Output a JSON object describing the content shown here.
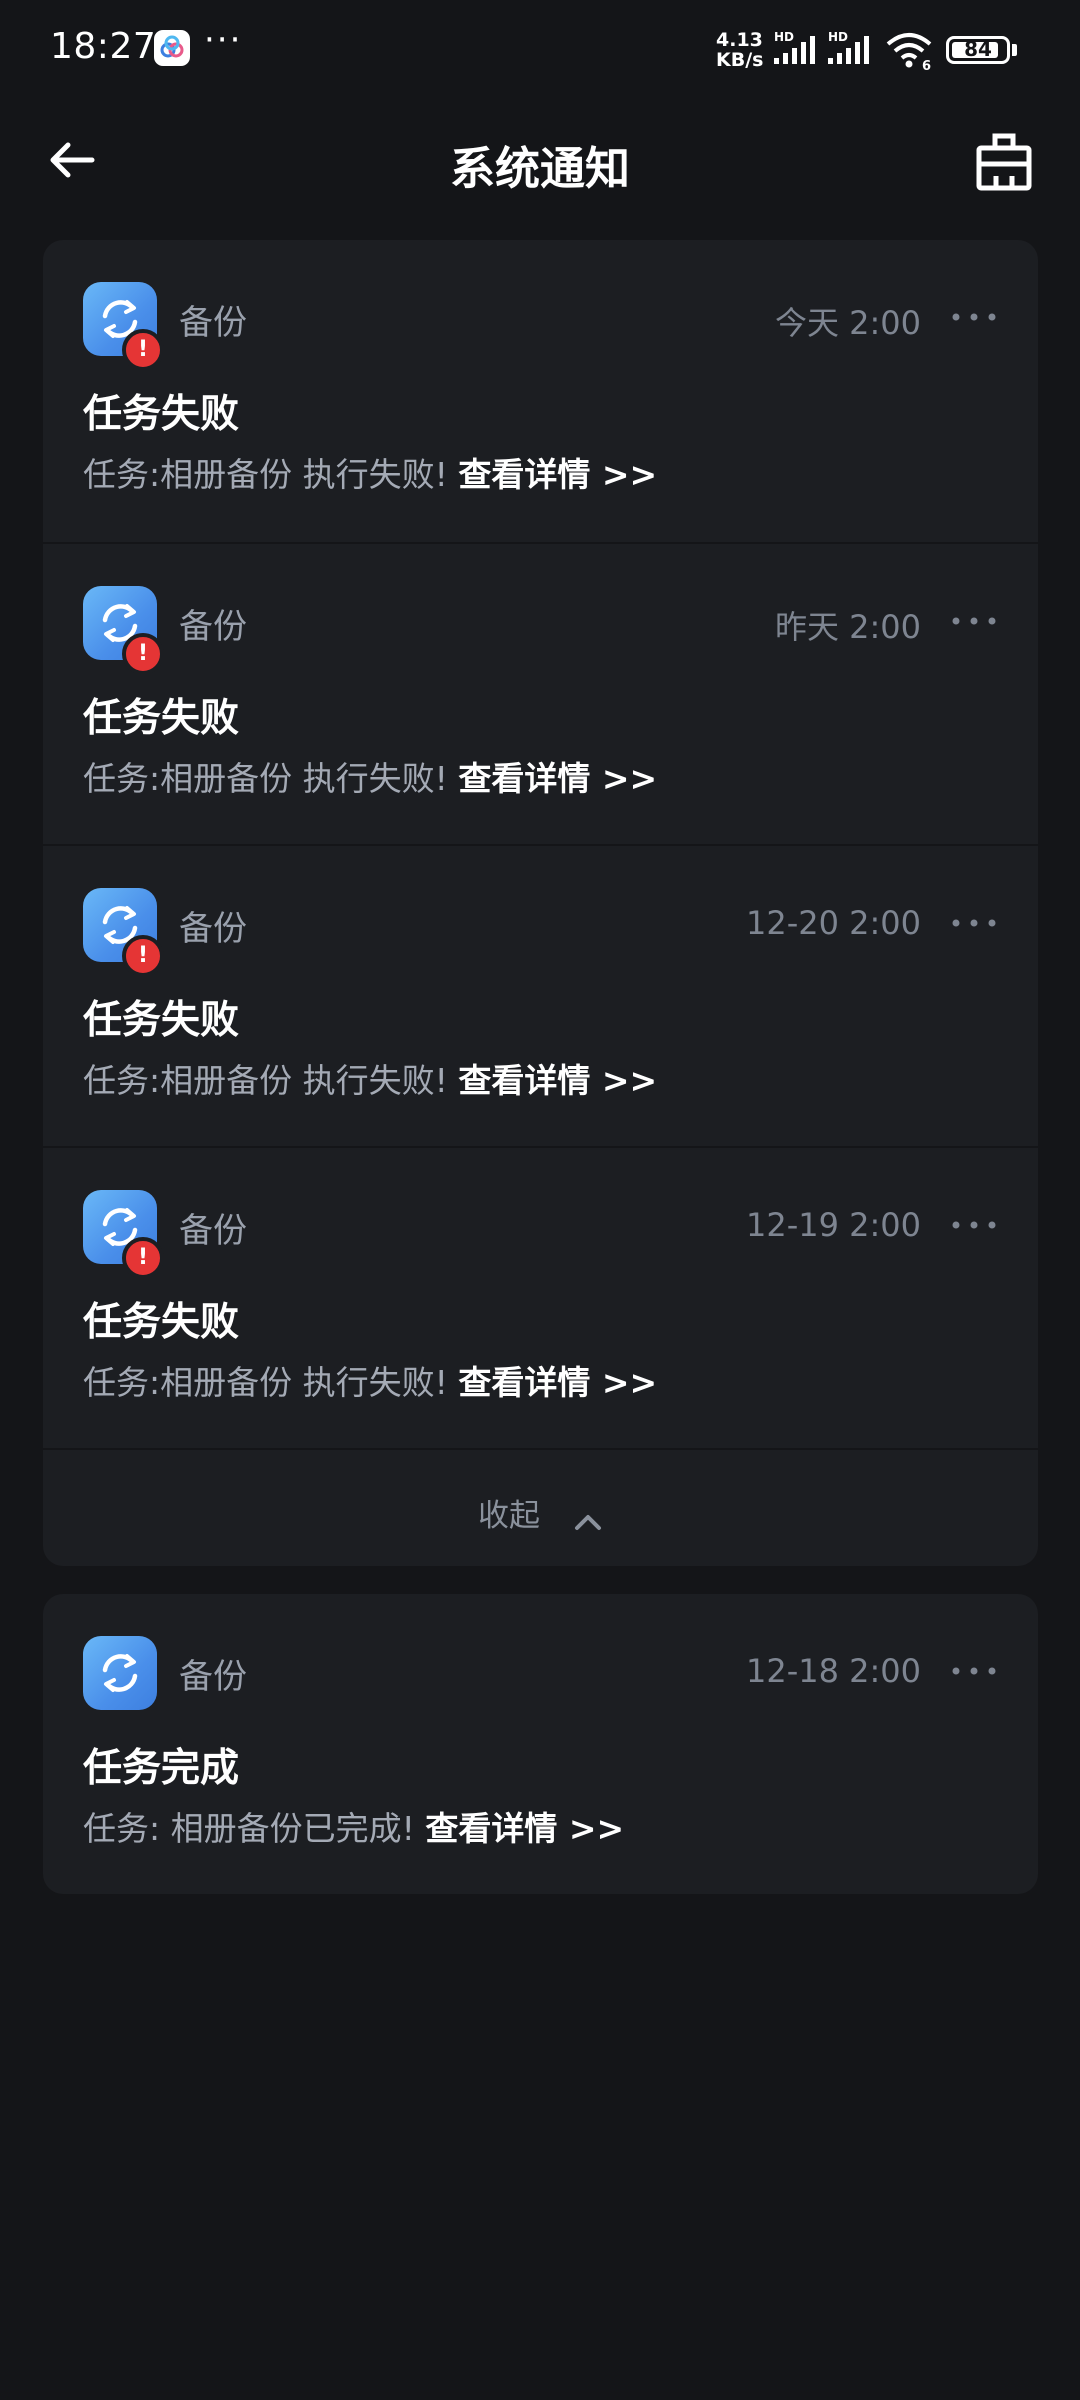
{
  "status_bar": {
    "time": "18:27",
    "dots": "···",
    "net_speed_value": "4.13",
    "net_speed_unit": "KB/s",
    "signal_label": "HD",
    "signal_label2": "HD",
    "wifi_sub": "6",
    "battery": "84"
  },
  "header": {
    "title": "系统通知",
    "back_icon": "arrow-left-icon",
    "clear_icon": "clear-all-icon"
  },
  "groups": [
    {
      "notifications": [
        {
          "app": "备份",
          "time": "今天 2:00",
          "title": "任务失败",
          "body": "任务:相册备份 执行失败! ",
          "link": "查看详情 >>",
          "error": true
        },
        {
          "app": "备份",
          "time": "昨天 2:00",
          "title": "任务失败",
          "body": "任务:相册备份 执行失败! ",
          "link": "查看详情 >>",
          "error": true
        },
        {
          "app": "备份",
          "time": "12-20 2:00",
          "title": "任务失败",
          "body": "任务:相册备份 执行失败! ",
          "link": "查看详情 >>",
          "error": true
        },
        {
          "app": "备份",
          "time": "12-19 2:00",
          "title": "任务失败",
          "body": "任务:相册备份 执行失败! ",
          "link": "查看详情 >>",
          "error": true
        }
      ],
      "collapse_label": "收起"
    },
    {
      "notifications": [
        {
          "app": "备份",
          "time": "12-18 2:00",
          "title": "任务完成",
          "body": "任务: 相册备份已完成! ",
          "link": "查看详情 >>",
          "error": false
        }
      ]
    }
  ],
  "badge_glyph": "!",
  "colors": {
    "background": "#141518",
    "card": "#1c1e22",
    "accent_blue": "#4a8fea",
    "error_red": "#e53535"
  }
}
